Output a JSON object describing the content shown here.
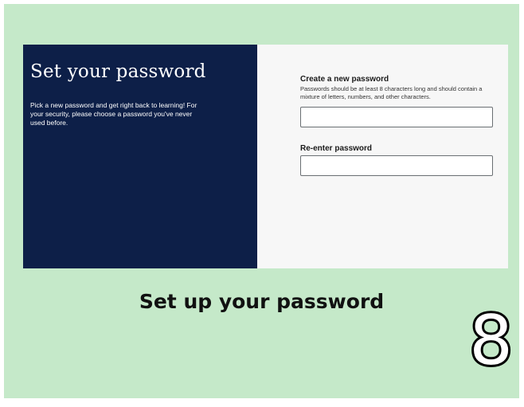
{
  "left_panel": {
    "title": "Set your password",
    "description": "Pick a new password and get right back to learning! For your security, please choose a password you've never used before."
  },
  "form": {
    "new_password": {
      "label": "Create a new password",
      "help": "Passwords should be at least 8 characters long and should contain a mixture of letters, numbers, and other characters.",
      "value": ""
    },
    "confirm_password": {
      "label": "Re-enter password",
      "value": ""
    }
  },
  "caption": "Set up your password",
  "step_number": "8",
  "colors": {
    "background": "#c5e9c9",
    "left_panel": "#0d1f48",
    "right_panel": "#f7f7f7"
  }
}
